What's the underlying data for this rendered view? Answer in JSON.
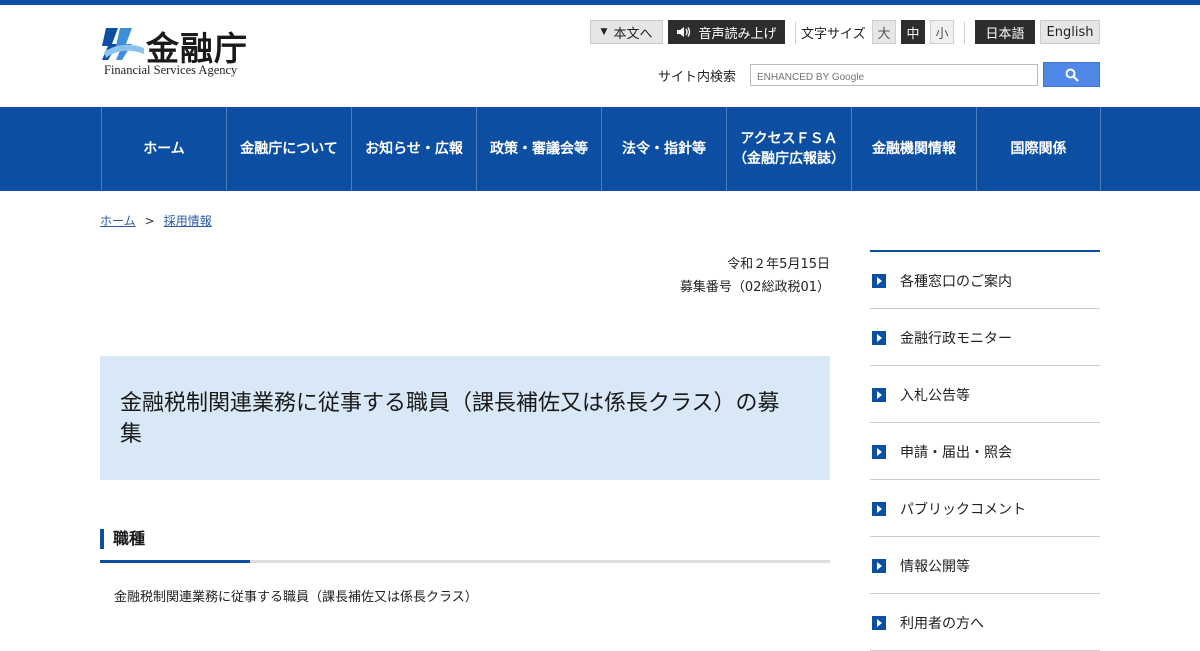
{
  "header": {
    "logo_text": "金融庁",
    "logo_sub": "Financial Services Agency",
    "skip_to_content": "本文へ",
    "read_aloud": "音声読み上げ",
    "font_size_label": "文字サイズ",
    "font_sizes": [
      "大",
      "中",
      "小"
    ],
    "languages": [
      "日本語",
      "English"
    ],
    "search_label": "サイト内検索",
    "search_placeholder": "ENHANCED BY Google"
  },
  "nav": [
    {
      "line1": "ホーム",
      "line2": ""
    },
    {
      "line1": "金融庁について",
      "line2": ""
    },
    {
      "line1": "お知らせ・広報",
      "line2": ""
    },
    {
      "line1": "政策・審議会等",
      "line2": ""
    },
    {
      "line1": "法令・指針等",
      "line2": ""
    },
    {
      "line1": "アクセスＦＳＡ",
      "line2": "（金融庁広報誌）"
    },
    {
      "line1": "金融機関情報",
      "line2": ""
    },
    {
      "line1": "国際関係",
      "line2": ""
    }
  ],
  "breadcrumb": {
    "home": "ホーム",
    "separator": ">",
    "current": "採用情報"
  },
  "main": {
    "date": "令和２年5月15日",
    "recruit_number": "募集番号（02総政税01）",
    "title": "金融税制関連業務に従事する職員（課長補佐又は係長クラス）の募集",
    "section_heading": "職種",
    "section_body": "金融税制関連業務に従事する職員（課長補佐又は係長クラス）"
  },
  "side_menu": [
    "各種窓口のご案内",
    "金融行政モニター",
    "入札公告等",
    "申請・届出・照会",
    "パブリックコメント",
    "情報公開等",
    "利用者の方へ"
  ],
  "colors": {
    "brand": "#0b4ea2",
    "title_bg": "#d9e8f7",
    "search_button": "#4f88e8"
  }
}
